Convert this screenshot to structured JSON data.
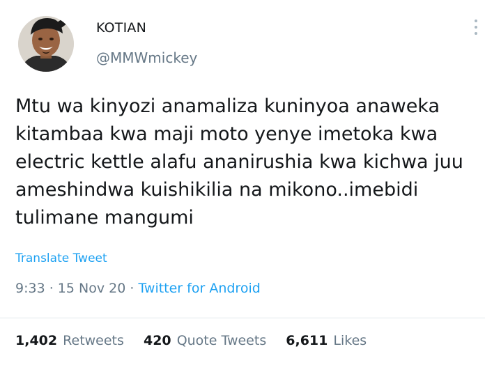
{
  "author": {
    "display_name": "KOTIAN",
    "handle": "@MMWmickey",
    "avatar_icon": "avatar-portrait-icon"
  },
  "menu": {
    "icon": "more-vertical-icon"
  },
  "tweet": {
    "text": "Mtu wa kinyozi anamaliza kuninyoa anaweka kitambaa kwa maji moto yenye imetoka kwa electric kettle alafu ananirushia kwa kichwa juu ameshindwa kuishikilia na mikono..imebidi tulimane mangumi",
    "translate_label": "Translate Tweet",
    "time": "9:33",
    "separator": " · ",
    "date": "15 Nov 20",
    "source": "Twitter for Android"
  },
  "stats": {
    "retweets_count": "1,402",
    "retweets_label": "Retweets",
    "quotes_count": "420",
    "quotes_label": "Quote Tweets",
    "likes_count": "6,611",
    "likes_label": "Likes"
  },
  "colors": {
    "link": "#1da1f2",
    "secondary": "#657786",
    "primary": "#14171a",
    "divider": "#e1e8ed"
  }
}
